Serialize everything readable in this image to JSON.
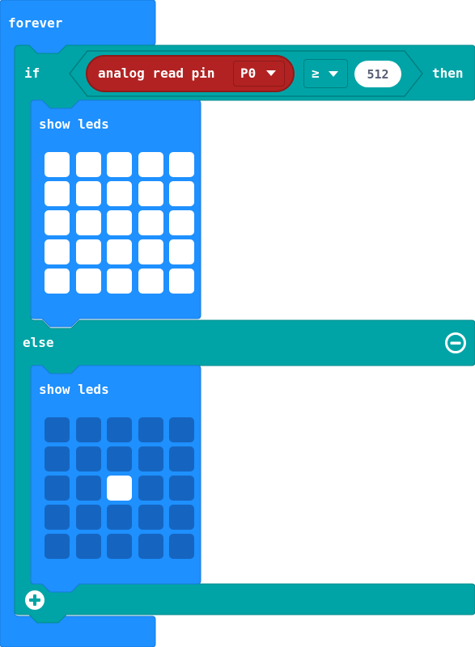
{
  "forever_label": "forever",
  "if_label": "if",
  "then_label": "then",
  "else_label": "else",
  "condition": {
    "reporter_label": "analog read pin",
    "pin_value": "P0",
    "operator": "≥",
    "threshold": "512"
  },
  "if_branch": {
    "label": "show leds",
    "leds": [
      [
        1,
        1,
        1,
        1,
        1
      ],
      [
        1,
        1,
        1,
        1,
        1
      ],
      [
        1,
        1,
        1,
        1,
        1
      ],
      [
        1,
        1,
        1,
        1,
        1
      ],
      [
        1,
        1,
        1,
        1,
        1
      ]
    ]
  },
  "else_branch": {
    "label": "show leds",
    "leds": [
      [
        0,
        0,
        0,
        0,
        0
      ],
      [
        0,
        0,
        0,
        0,
        0
      ],
      [
        0,
        0,
        1,
        0,
        0
      ],
      [
        0,
        0,
        0,
        0,
        0
      ],
      [
        0,
        0,
        0,
        0,
        0
      ]
    ]
  },
  "icons": {
    "remove_else": "minus-circle-icon",
    "add_branch": "plus-circle-icon",
    "dropdown": "triangle-down-icon"
  },
  "colors": {
    "loops_blue": "#1e90ff",
    "logic_teal": "#00a4a6",
    "pins_red": "#b22222",
    "led_on": "#ffffff",
    "led_off": "#1565c0"
  }
}
